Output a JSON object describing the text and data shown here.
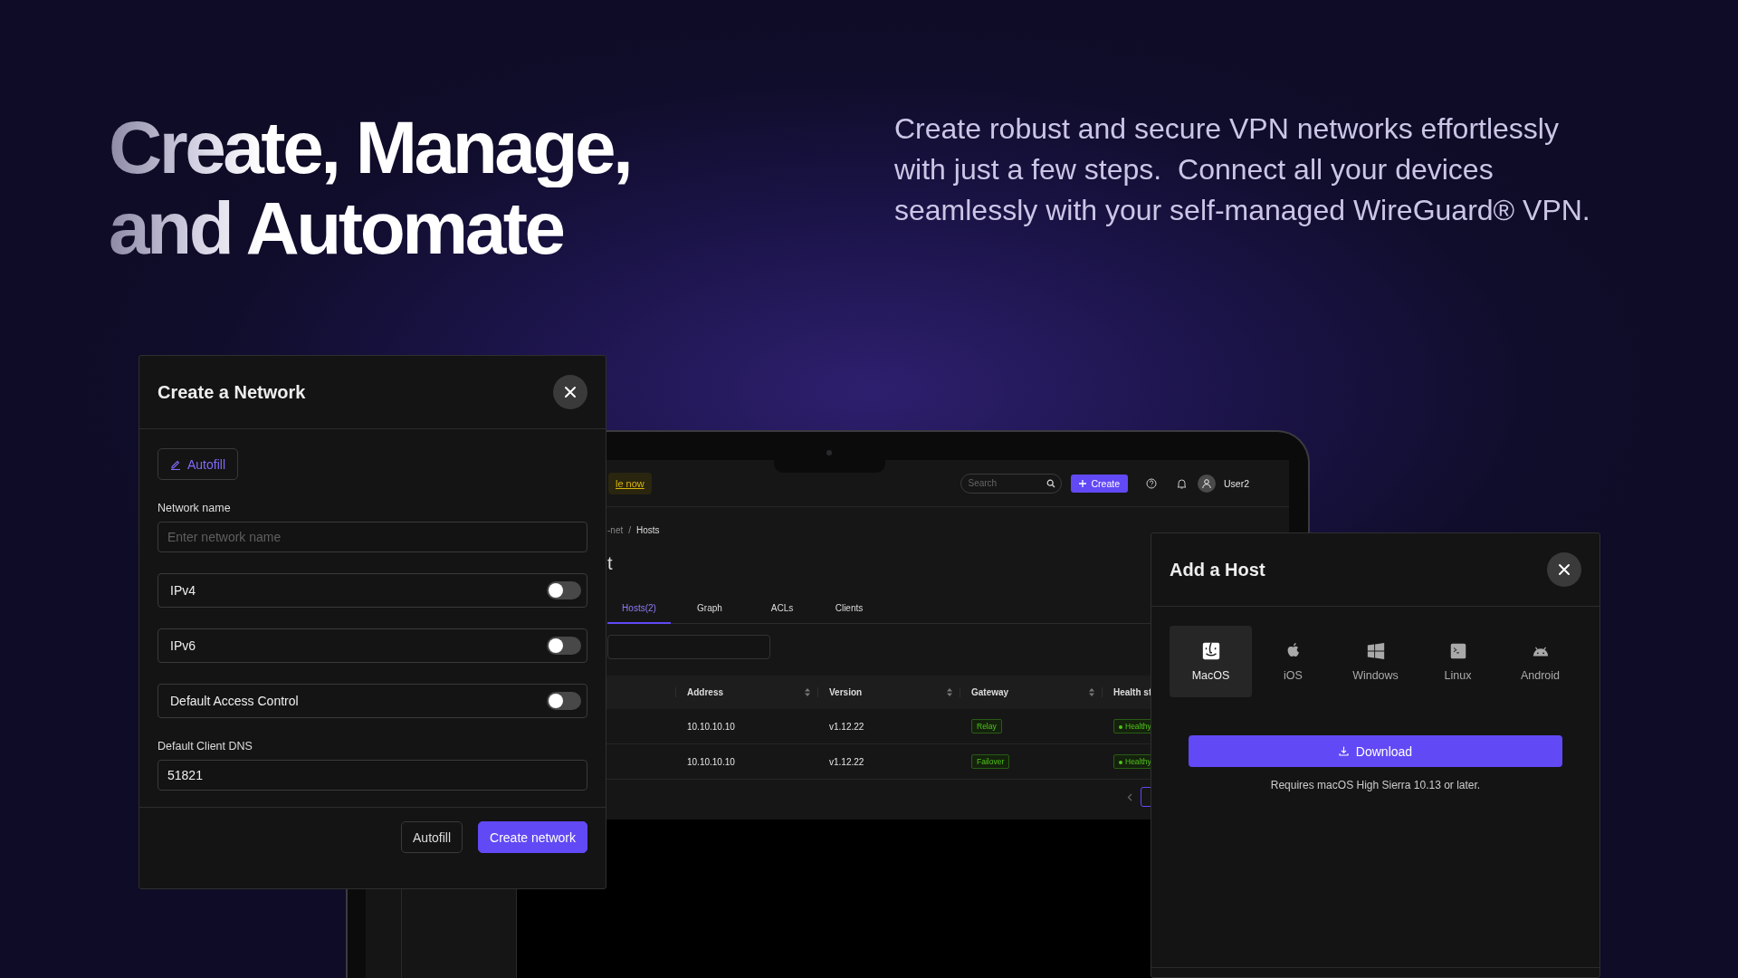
{
  "hero": {
    "headline_lines": [
      "Create, Manage,",
      "and Automate"
    ],
    "description_lines": [
      "Create robust and secure VPN networks effortlessly",
      "with just a few steps.  Connect all your devices",
      "seamlessly with your self-managed WireGuard® VPN."
    ]
  },
  "laptop_app": {
    "banner_link": "le now",
    "search": {
      "placeholder": "Search"
    },
    "create_button": "Create",
    "user": "User2",
    "breadcrumb": {
      "items": [
        "-net",
        "Hosts"
      ],
      "separator": "/"
    },
    "page_title": "t",
    "tabs": [
      {
        "label": "Hosts(2)",
        "selected": true
      },
      {
        "label": "Graph",
        "selected": false
      },
      {
        "label": "ACLs",
        "selected": false
      },
      {
        "label": "Clients",
        "selected": false
      }
    ],
    "table": {
      "columns": [
        "Address",
        "Version",
        "Gateway",
        "Health st"
      ],
      "rows": [
        {
          "address": "10.10.10.10",
          "version": "v1.12.22",
          "gateway": "Relay",
          "health": "Healthy"
        },
        {
          "address": "10.10.10.10",
          "version": "v1.12.22",
          "gateway": "Failover",
          "health": "Healthy"
        }
      ]
    }
  },
  "create_network_dialog": {
    "title": "Create a Network",
    "autofill_button": "Autofill",
    "name_field": {
      "label": "Network name",
      "placeholder": "Enter network name"
    },
    "toggles": [
      {
        "label": "IPv4",
        "on": false
      },
      {
        "label": "IPv6",
        "on": false
      },
      {
        "label": "Default Access Control",
        "on": false
      }
    ],
    "dns_field": {
      "label": "Default Client DNS",
      "value": "51821"
    },
    "buttons": [
      {
        "label": "Autofill",
        "kind": "secondary"
      },
      {
        "label": "Create network",
        "kind": "primary"
      }
    ]
  },
  "add_host_dialog": {
    "title": "Add a Host",
    "platforms": [
      {
        "label": "MacOS",
        "selected": true
      },
      {
        "label": "iOS",
        "selected": false
      },
      {
        "label": "Windows",
        "selected": false
      },
      {
        "label": "Linux",
        "selected": false
      },
      {
        "label": "Android",
        "selected": false
      }
    ],
    "download_button": "Download",
    "note": "Requires macOS High Sierra 10.13 or later."
  }
}
